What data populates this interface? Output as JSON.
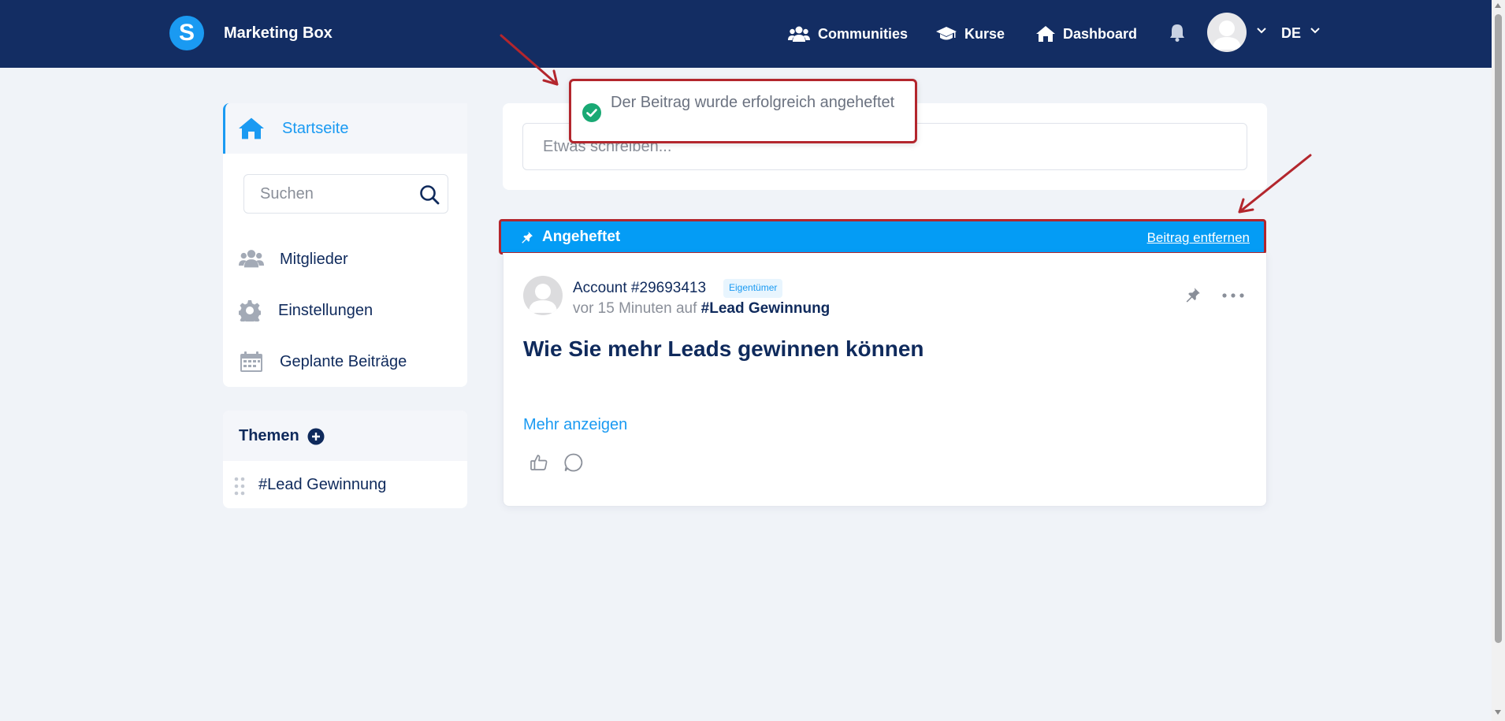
{
  "header": {
    "logo_letter": "S",
    "brand": "Marketing Box",
    "nav": {
      "communities": "Communities",
      "courses": "Kurse",
      "dashboard": "Dashboard"
    },
    "language": "DE"
  },
  "sidebar": {
    "home": "Startseite",
    "search_placeholder": "Suchen",
    "links": {
      "members": "Mitglieder",
      "settings": "Einstellungen",
      "scheduled": "Geplante Beiträge"
    },
    "themes": {
      "title": "Themen",
      "items": [
        "#Lead Gewinnung"
      ]
    }
  },
  "compose": {
    "placeholder": "Etwas schreiben..."
  },
  "toast": {
    "message": "Der Beitrag wurde erfolgreich angeheftet"
  },
  "pinned": {
    "label": "Angeheftet",
    "remove": "Beitrag entfernen"
  },
  "post": {
    "author": "Account #29693413",
    "badge": "Eigentümer",
    "meta_prefix": "vor 15 Minuten auf ",
    "topic": "#Lead Gewinnung",
    "title": "Wie Sie mehr Leads gewinnen können",
    "more": "Mehr anzeigen"
  },
  "colors": {
    "topbar": "#132d63",
    "accent": "#1a9af2",
    "pinned_bar": "#049cf5",
    "annotation": "#b3262d",
    "success": "#19a974"
  }
}
